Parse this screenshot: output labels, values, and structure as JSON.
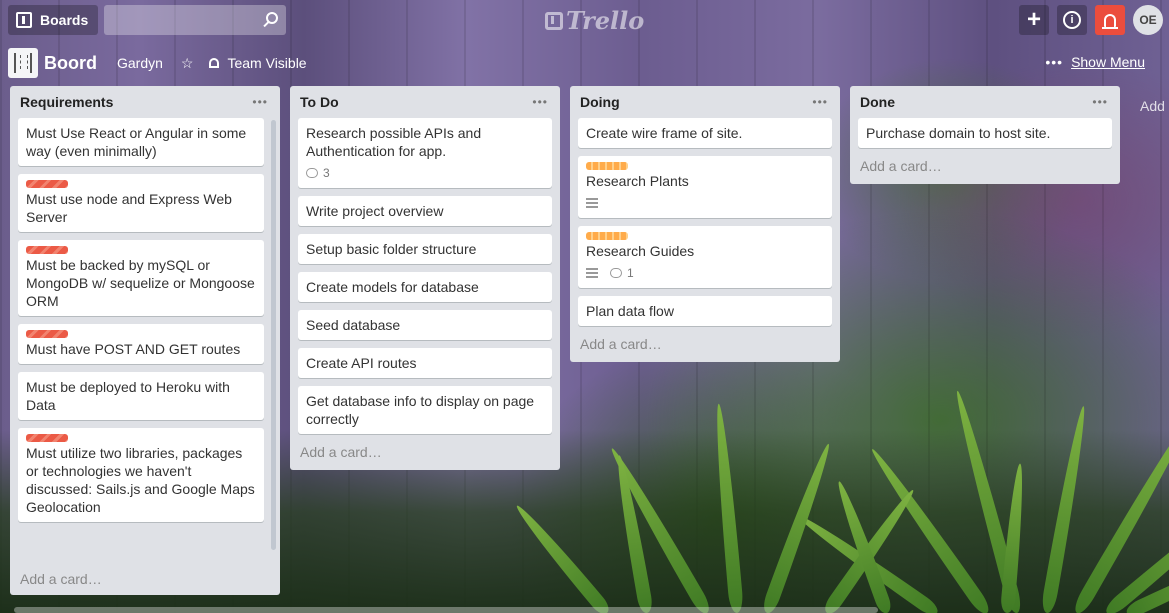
{
  "header": {
    "boards_label": "Boards",
    "search_value": "",
    "logo_text": "Trello",
    "avatar_initials": "OE"
  },
  "board": {
    "title": "Boord",
    "org": "Gardyn",
    "visibility": "Team Visible",
    "show_menu": "Show Menu",
    "add_list": "Add"
  },
  "colors": {
    "label_red": "#eb5a46",
    "label_orange": "#ffab4a",
    "notification": "#eb4d3d",
    "list_bg": "#dfe1e6"
  },
  "lists": [
    {
      "title": "Requirements",
      "add_card": "Add a card…",
      "cards": [
        {
          "text": "Must Use React or Angular in some way (even minimally)"
        },
        {
          "text": "Must use node and Express Web Server",
          "label": "red"
        },
        {
          "text": "Must be backed by mySQL or MongoDB w/ sequelize or Mongoose ORM",
          "label": "red"
        },
        {
          "text": "Must have POST AND GET routes",
          "label": "red"
        },
        {
          "text": "Must be deployed to Heroku with Data"
        },
        {
          "text": "Must utilize two libraries, packages or technologies we haven't discussed: Sails.js and Google Maps Geolocation",
          "label": "red"
        }
      ]
    },
    {
      "title": "To Do",
      "add_card": "Add a card…",
      "cards": [
        {
          "text": "Research possible APIs and Authentication for app.",
          "comments": "3"
        },
        {
          "text": "Write project overview"
        },
        {
          "text": "Setup basic folder structure"
        },
        {
          "text": "Create models for database"
        },
        {
          "text": "Seed database"
        },
        {
          "text": "Create API routes"
        },
        {
          "text": "Get database info to display on page correctly"
        }
      ]
    },
    {
      "title": "Doing",
      "add_card": "Add a card…",
      "cards": [
        {
          "text": "Create wire frame of site."
        },
        {
          "text": "Research Plants",
          "label": "orange",
          "description": true
        },
        {
          "text": "Research Guides",
          "label": "orange",
          "description": true,
          "comments": "1"
        },
        {
          "text": "Plan data flow"
        }
      ]
    },
    {
      "title": "Done",
      "add_card": "Add a card…",
      "cards": [
        {
          "text": "Purchase domain to host site."
        }
      ]
    }
  ]
}
